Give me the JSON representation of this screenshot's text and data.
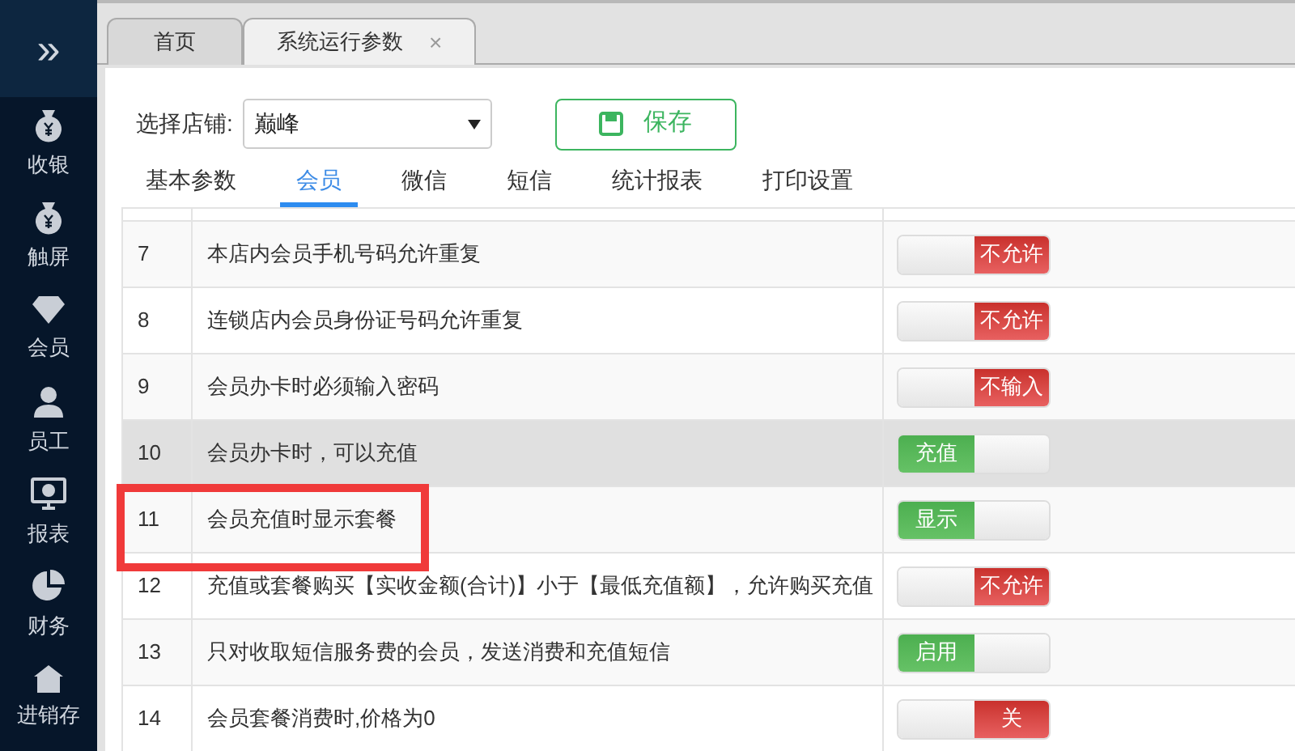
{
  "sidebar": {
    "toggle": "»",
    "items": [
      {
        "label": "收银",
        "kind": "moneybag"
      },
      {
        "label": "触屏",
        "kind": "moneybag"
      },
      {
        "label": "会员",
        "kind": "diamond"
      },
      {
        "label": "员工",
        "kind": "person"
      },
      {
        "label": "报表",
        "kind": "monitor"
      },
      {
        "label": "财务",
        "kind": "pie"
      },
      {
        "label": "进销存",
        "kind": "house"
      }
    ]
  },
  "page_tabs": [
    {
      "label": "首页",
      "selected": false
    },
    {
      "label": "系统运行参数",
      "selected": true,
      "close": "×"
    }
  ],
  "store": {
    "label": "选择店铺:",
    "value": "巅峰"
  },
  "save_button": "保存",
  "section_tabs": [
    {
      "label": "基本参数",
      "selected": false
    },
    {
      "label": "会员",
      "selected": true
    },
    {
      "label": "微信",
      "selected": false
    },
    {
      "label": "短信",
      "selected": false
    },
    {
      "label": "统计报表",
      "selected": false
    },
    {
      "label": "打印设置",
      "selected": false
    }
  ],
  "rows": [
    {
      "no": "7",
      "text": "本店内会员手机号码允许重复",
      "on": false,
      "toggle_label": "不允许",
      "hovered": false,
      "marked": false
    },
    {
      "no": "8",
      "text": "连锁店内会员身份证号码允许重复",
      "on": false,
      "toggle_label": "不允许",
      "hovered": false,
      "marked": false
    },
    {
      "no": "9",
      "text": "会员办卡时必须输入密码",
      "on": false,
      "toggle_label": "不输入",
      "hovered": false,
      "marked": false
    },
    {
      "no": "10",
      "text": "会员办卡时，可以充值",
      "on": true,
      "toggle_label": "充值",
      "hovered": true,
      "marked": false
    },
    {
      "no": "11",
      "text": "会员充值时显示套餐",
      "on": true,
      "toggle_label": "显示",
      "hovered": false,
      "marked": true
    },
    {
      "no": "12",
      "text": "充值或套餐购买【实收金额(合计)】小于【最低充值额】，允许购买充值",
      "on": false,
      "toggle_label": "不允许",
      "hovered": false,
      "marked": false
    },
    {
      "no": "13",
      "text": "只对收取短信服务费的会员，发送消费和充值短信",
      "on": true,
      "toggle_label": "启用",
      "hovered": false,
      "marked": false
    },
    {
      "no": "14",
      "text": "会员套餐消费时,价格为0",
      "on": false,
      "toggle_label": "关",
      "hovered": false,
      "marked": false
    }
  ]
}
